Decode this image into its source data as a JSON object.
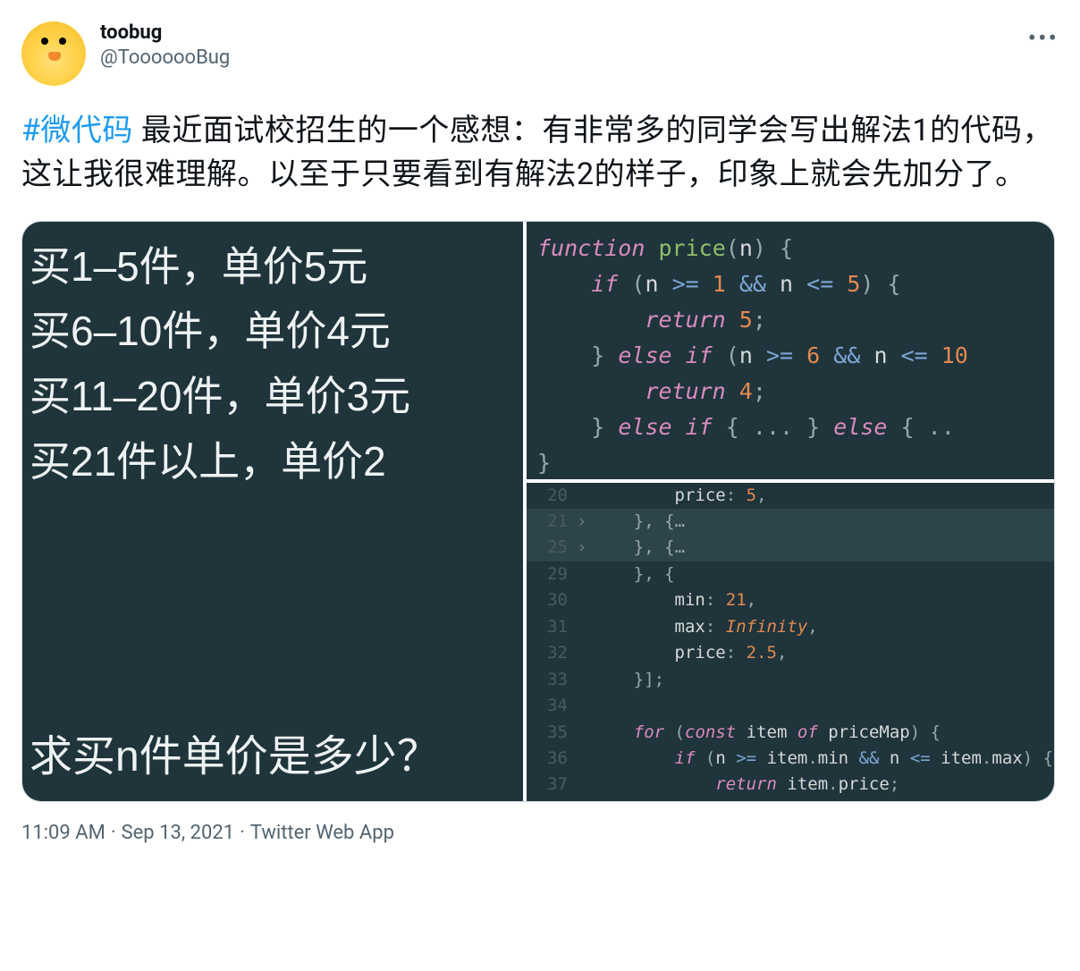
{
  "user": {
    "name": "toobug",
    "handle": "@TooooooBug"
  },
  "tweet": {
    "hashtag": "#微代码",
    "text": " 最近面试校招生的一个感想：有非常多的同学会写出解法1的代码，这让我很难理解。以至于只要看到有解法2的样子，印象上就会先加分了。"
  },
  "image1": {
    "lines": [
      "买1–5件，单价5元",
      "买6–10件，单价4元",
      "买11–20件，单价3元",
      "买21件以上，单价2"
    ],
    "ask": "求买n件单价是多少？"
  },
  "code1": {
    "lang": "js"
  },
  "code2": {
    "gutter": [
      "20",
      "21",
      "25",
      "29",
      "30",
      "31",
      "32",
      "33",
      "34",
      "35",
      "36",
      "37"
    ]
  },
  "meta": {
    "time": "11:09 AM",
    "date": "Sep 13, 2021",
    "client": "Twitter Web App"
  }
}
